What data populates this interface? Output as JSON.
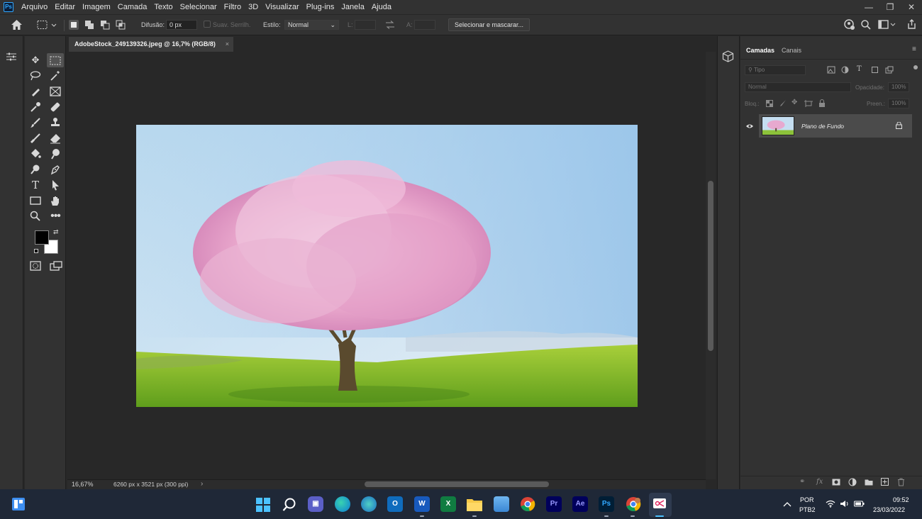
{
  "app": {
    "logo": "Ps"
  },
  "menu": [
    "Arquivo",
    "Editar",
    "Imagem",
    "Camada",
    "Texto",
    "Selecionar",
    "Filtro",
    "3D",
    "Visualizar",
    "Plug-ins",
    "Janela",
    "Ajuda"
  ],
  "window_controls": {
    "minimize": "—",
    "restore": "❐",
    "close": "✕"
  },
  "options": {
    "feather_label": "Difusão:",
    "feather_value": "0 px",
    "antialias_label": "Suav. Serrilh.",
    "style_label": "Estilo:",
    "style_value": "Normal",
    "width_label": "L:",
    "height_label": "A:",
    "select_mask_button": "Selecionar e mascarar..."
  },
  "document": {
    "tab_title": "AdobeStock_249139326.jpeg @ 16,7% (RGB/8)",
    "close_glyph": "×",
    "zoom": "16,67%",
    "info": "6260 px x 3521 px (300 ppi)",
    "status_arrow": "›"
  },
  "panels": {
    "tabs": [
      "Camadas",
      "Canais"
    ],
    "kind_placeholder": "Tipo",
    "blend_mode": "Normal",
    "opacity_label": "Opacidade:",
    "opacity_value": "100%",
    "lock_label": "Bloq.:",
    "fill_label": "Preen.:",
    "fill_value": "100%",
    "layers": [
      {
        "name": "Plano de Fundo",
        "visible": true,
        "locked": true
      }
    ],
    "footer_fx": "fx"
  },
  "taskbar": {
    "apps": [
      "start",
      "search",
      "teams",
      "edge",
      "network",
      "outlook",
      "word",
      "excel",
      "explorer",
      "photos",
      "chrome",
      "premiere",
      "after-effects",
      "photoshop",
      "chrome-profile",
      "snipping"
    ],
    "app_labels": {
      "premiere": "Pr",
      "after_effects": "Ae",
      "photoshop": "Ps",
      "word": "W",
      "excel": "X",
      "outlook": "O"
    },
    "language_line1": "POR",
    "language_line2": "PTB2",
    "time": "09:52",
    "date": "23/03/2022"
  },
  "colors": {
    "accent": "#31a8ff",
    "foreground_swatch": "#000000",
    "background_swatch": "#ffffff"
  }
}
